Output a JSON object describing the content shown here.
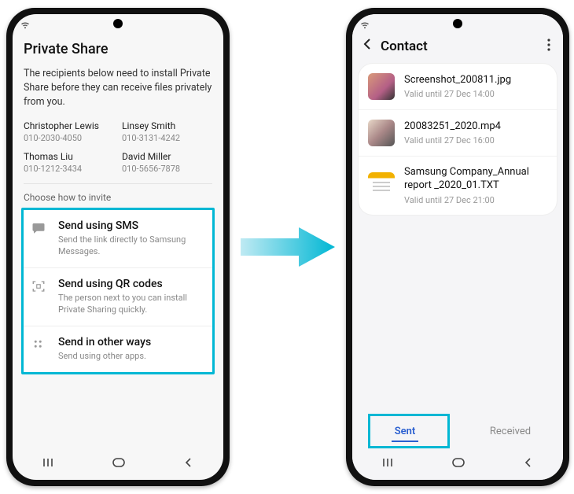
{
  "left": {
    "title": "Private Share",
    "description": "The recipients below need to install Private Share before they can receive files privately from you.",
    "recipients": [
      {
        "name": "Christopher Lewis",
        "number": "010-2030-4050"
      },
      {
        "name": "Linsey Smith",
        "number": "010-3131-4242"
      },
      {
        "name": "Thomas Liu",
        "number": "010-1212-3434"
      },
      {
        "name": "David Miller",
        "number": "010-5656-7878"
      }
    ],
    "choose_label": "Choose how to invite",
    "options": [
      {
        "title": "Send using SMS",
        "sub": "Send the link directly to Samsung Messages."
      },
      {
        "title": "Send using QR codes",
        "sub": "The person next to you can install Private Sharing quickly."
      },
      {
        "title": "Send in other ways",
        "sub": "Send using other apps."
      }
    ]
  },
  "right": {
    "header": "Contact",
    "files": [
      {
        "name": "Screenshot_200811.jpg",
        "valid": "Valid until 27 Dec 14:00"
      },
      {
        "name": "20083251_2020.mp4",
        "valid": "Valid until 27 Dec 16:00"
      },
      {
        "name": "Samsung Company_Annual report _2020_01.TXT",
        "valid": "Valid until 27 Dec 21:00"
      }
    ],
    "tabs": {
      "sent": "Sent",
      "received": "Received"
    }
  },
  "nav": {
    "recents": "|||",
    "home": "◯",
    "back": "‹"
  },
  "colors": {
    "highlight": "#00b7d4",
    "accent": "#2a5fd0"
  }
}
